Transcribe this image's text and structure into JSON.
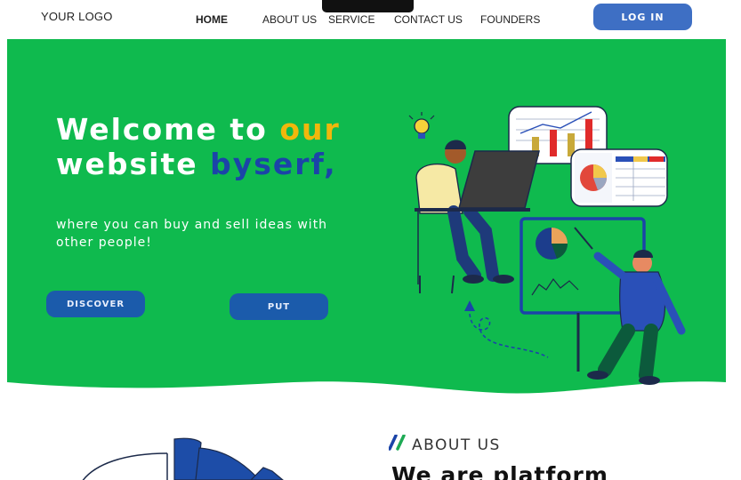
{
  "nav": {
    "logo": "YOUR LOGO",
    "items": [
      {
        "label": "HOME",
        "active": true
      },
      {
        "label": "ABOUT US"
      },
      {
        "label": "SERVICE"
      },
      {
        "label": "CONTACT US"
      },
      {
        "label": "FOUNDERS"
      }
    ],
    "login_label": "LOG IN"
  },
  "hero": {
    "title_line1_a": "Welcome to ",
    "title_line1_b": "our",
    "title_line2_a": "website ",
    "title_line2_b": "byserf,",
    "subtitle": "where you can buy and sell ideas with other people!",
    "buttons": {
      "discover": "DISCOVER",
      "put": "PUT"
    }
  },
  "about": {
    "label": "ABOUT US",
    "heading": "We are platform"
  },
  "colors": {
    "hero_green": "#0fba4e",
    "accent_yellow": "#f1b70c",
    "accent_blue": "#1b44a8",
    "button_blue": "#1b5bab",
    "login_blue": "#3e6fc4"
  }
}
